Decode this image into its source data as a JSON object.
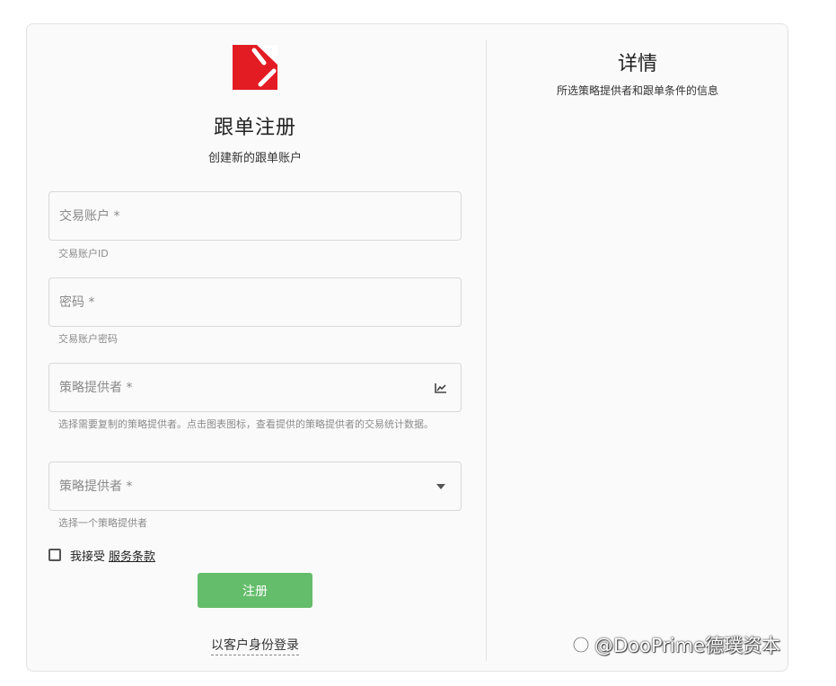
{
  "form": {
    "title": "跟单注册",
    "subtitle": "创建新的跟单账户",
    "fields": [
      {
        "placeholder": "交易账户 *",
        "helper": "交易账户ID"
      },
      {
        "placeholder": "密码 *",
        "helper": "交易账户密码"
      },
      {
        "placeholder": "策略提供者 *",
        "helper": "选择需要复制的策略提供者。点击图表图标，查看提供的策略提供者的交易统计数据。",
        "icon": "chart-icon"
      },
      {
        "placeholder": "策略提供者 *",
        "helper": "选择一个策略提供者",
        "icon": "caret-down-icon"
      }
    ],
    "terms": {
      "prefix": "我接受",
      "link": "服务条款"
    },
    "register_label": "注册",
    "client_login": "以客户身份登录"
  },
  "details": {
    "title": "详情",
    "subtitle": "所选策略提供者和跟单条件的信息"
  },
  "watermark": {
    "text": "@DooPrime德璞资本"
  },
  "colors": {
    "brand_red": "#e31b23",
    "button_green": "#64bd6a",
    "border": "#d8d8d8",
    "helper_text": "#8c8c8c"
  }
}
